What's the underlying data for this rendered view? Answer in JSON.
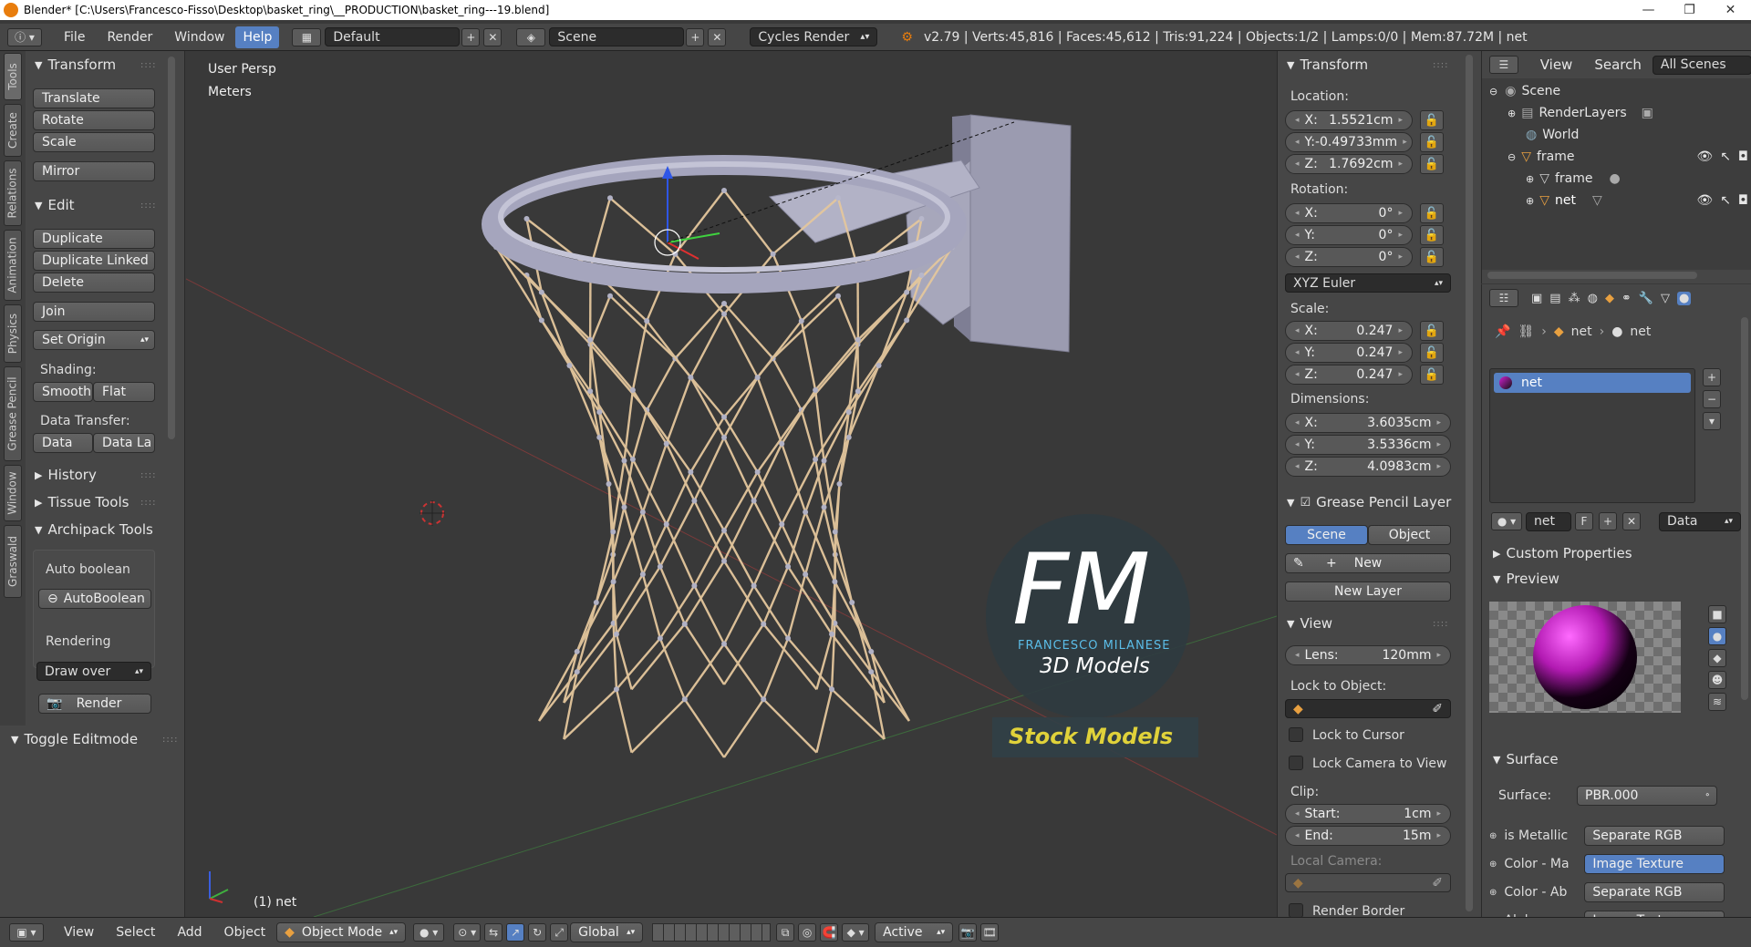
{
  "window": {
    "title": "Blender* [C:\\Users\\Francesco-Fisso\\Desktop\\basket_ring\\__PRODUCTION\\basket_ring---19.blend]"
  },
  "menu": {
    "file": "File",
    "render": "Render",
    "window": "Window",
    "help": "Help"
  },
  "header": {
    "screen_layout": "Default",
    "scene": "Scene",
    "render_engine": "Cycles Render",
    "stats": "v2.79 | Verts:45,816 | Faces:45,612 | Tris:91,224 | Objects:1/2 | Lamps:0/0 | Mem:87.72M | net"
  },
  "tool_tabs": [
    "Tools",
    "Create",
    "Relations",
    "Animation",
    "Physics",
    "Grease Pencil",
    "Window",
    "Graswald"
  ],
  "tools": {
    "transform_header": "Transform",
    "translate": "Translate",
    "rotate": "Rotate",
    "scale": "Scale",
    "mirror": "Mirror",
    "edit_header": "Edit",
    "duplicate": "Duplicate",
    "duplicate_linked": "Duplicate Linked",
    "delete": "Delete",
    "join": "Join",
    "set_origin": "Set Origin",
    "shading_label": "Shading:",
    "smooth": "Smooth",
    "flat": "Flat",
    "data_transfer_label": "Data Transfer:",
    "data": "Data",
    "data_la": "Data La",
    "history": "History",
    "tissue_tools": "Tissue Tools",
    "archipack": "Archipack Tools",
    "auto_boolean_label": "Auto boolean",
    "autoboolean_button": "AutoBoolean",
    "rendering_label": "Rendering",
    "draw_over": "Draw over",
    "render_button": "Render",
    "toggle_editmode": "Toggle Editmode"
  },
  "viewport": {
    "view_name": "User Persp",
    "units": "Meters",
    "active_object_label": "(1) net",
    "watermark": {
      "letters": "FM",
      "name": "FRANCESCO MILANESE",
      "sub": "3D Models",
      "tag": "Stock Models"
    }
  },
  "properties_panel": {
    "transform_header": "Transform",
    "location_label": "Location:",
    "location": {
      "x": "1.5521cm",
      "y": "-0.49733mm",
      "z": "1.7692cm"
    },
    "rotation_label": "Rotation:",
    "rotation": {
      "x": "0°",
      "y": "0°",
      "z": "0°"
    },
    "rotation_mode": "XYZ Euler",
    "scale_label": "Scale:",
    "scale": {
      "x": "0.247",
      "y": "0.247",
      "z": "0.247"
    },
    "dimensions_label": "Dimensions:",
    "dimensions": {
      "x": "3.6035cm",
      "y": "3.5336cm",
      "z": "4.0983cm"
    },
    "grease_pencil_header": "Grease Pencil Layer",
    "gp_scene": "Scene",
    "gp_object": "Object",
    "gp_new": "New",
    "gp_new_layer": "New Layer",
    "view_header": "View",
    "lens_label": "Lens:",
    "lens": "120mm",
    "lock_to_object": "Lock to Object:",
    "lock_to_cursor": "Lock to Cursor",
    "lock_camera": "Lock Camera to View",
    "clip_label": "Clip:",
    "clip_start_label": "Start:",
    "clip_start": "1cm",
    "clip_end_label": "End:",
    "clip_end": "15m",
    "local_camera": "Local Camera:",
    "render_border": "Render Border",
    "axis": {
      "x": "X:",
      "y": "Y:",
      "z": "Z:"
    }
  },
  "outliner": {
    "view": "View",
    "search": "Search",
    "filter": "All Scenes",
    "rows": [
      "Scene",
      "RenderLayers",
      "World",
      "frame",
      "frame",
      "net"
    ]
  },
  "material": {
    "breadcrumb_object": "net",
    "breadcrumb_material": "net",
    "slot_name": "net",
    "material_name": "net",
    "f_label": "F",
    "link": "Data",
    "custom_properties": "Custom Properties",
    "preview": "Preview",
    "surface_header": "Surface",
    "surface_label": "Surface:",
    "surface_shader": "PBR.000",
    "inputs": [
      {
        "label": "is Metallic",
        "value": "Separate RGB"
      },
      {
        "label": "Color - Ma",
        "value": "Image Texture"
      },
      {
        "label": "Color - Ab",
        "value": "Separate RGB"
      },
      {
        "label": "Alpha:",
        "value": "Image Texture"
      }
    ]
  },
  "bottombar": {
    "view": "View",
    "select": "Select",
    "add": "Add",
    "object": "Object",
    "mode": "Object Mode",
    "orientation": "Global",
    "layer_mode": "Active"
  },
  "colors": {
    "accent": "#5680c2",
    "panel": "#464646",
    "viewport": "#393939",
    "net_rope": "#e8c9a0",
    "hoop": "#a5a5bd"
  }
}
